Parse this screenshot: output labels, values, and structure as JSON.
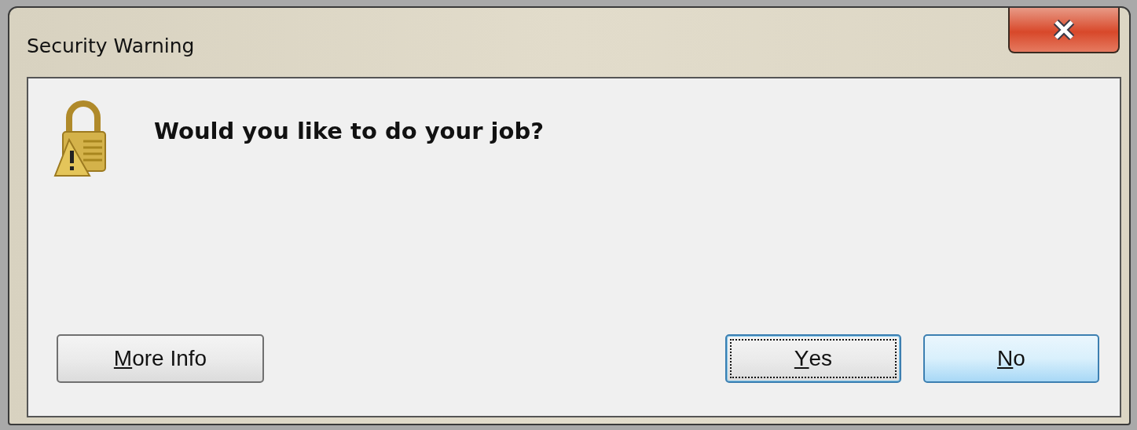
{
  "window": {
    "title": "Security Warning"
  },
  "message": "Would you like to do your job?",
  "buttons_left": [
    {
      "label": "More Info",
      "underline_first": true,
      "focused": false,
      "default": false
    }
  ],
  "buttons_right": [
    {
      "label": "Yes",
      "underline_first": true,
      "focused": true,
      "default": false
    },
    {
      "label": "No",
      "underline_first": true,
      "focused": false,
      "default": true
    }
  ]
}
